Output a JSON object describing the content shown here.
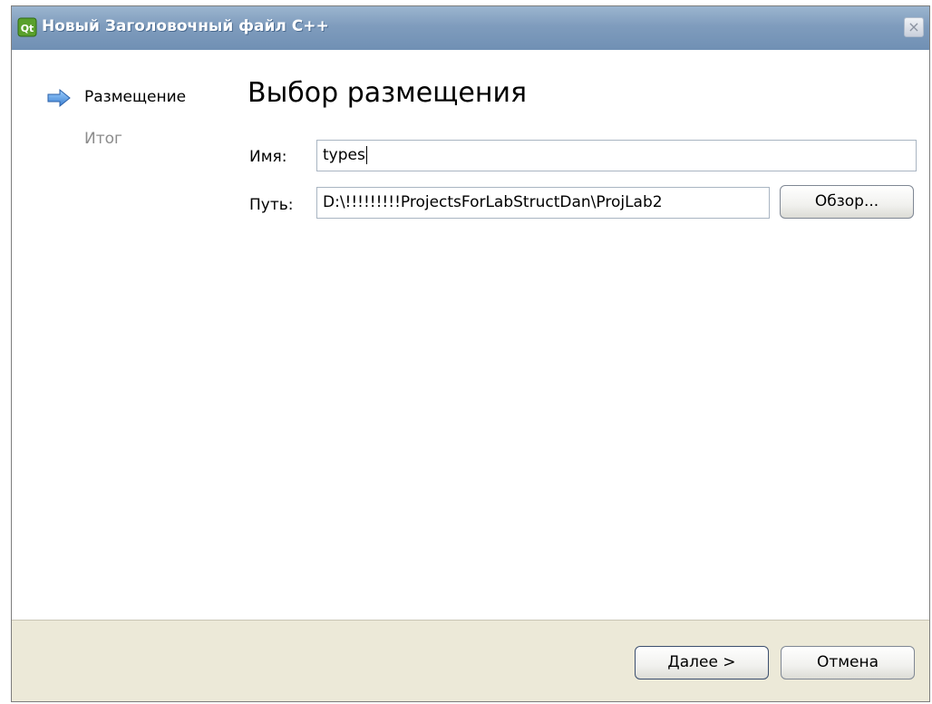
{
  "window": {
    "title": "Новый Заголовочный файл C++",
    "close_glyph": "×",
    "icon": "qt-creator-icon"
  },
  "wizard": {
    "steps": [
      {
        "label": "Размещение",
        "state": "current"
      },
      {
        "label": "Итог",
        "state": "pending"
      }
    ],
    "heading": "Выбор размещения"
  },
  "form": {
    "name_label": "Имя:",
    "name_value": "types",
    "path_label": "Путь:",
    "path_value": "D:\\!!!!!!!!!ProjectsForLabStructDan\\ProjLab2",
    "browse_label": "Обзор..."
  },
  "footer": {
    "next_accel": "Д",
    "next_rest": "алее >",
    "cancel_label": "Отмена"
  },
  "colors": {
    "titlebar": "#7f9cbd",
    "footer": "#ece9d8",
    "step_arrow": "#4f8fd8"
  }
}
